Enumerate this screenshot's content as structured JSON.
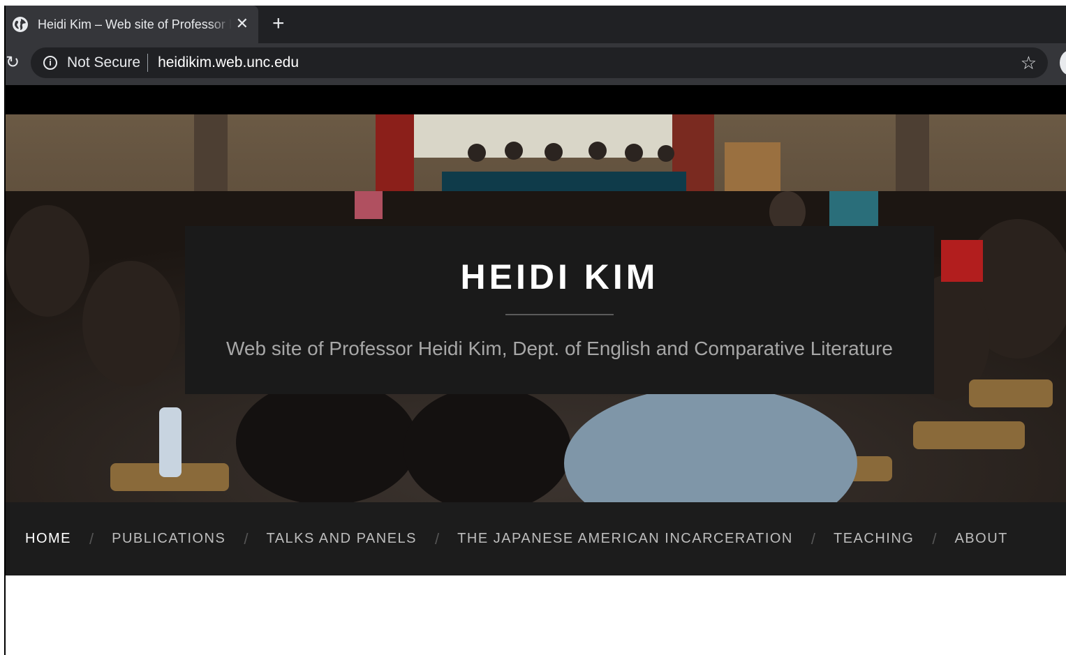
{
  "browser": {
    "tab_title": "Heidi Kim – Web site of Professor Heidi Kim, Dept. of English and Comparative Literature",
    "tab_close": "✕",
    "new_tab": "+",
    "reload_glyph": "↻",
    "security_label": "Not Secure",
    "url": "heidikim.web.unc.edu",
    "bookmark_glyph": "☆",
    "icons": [
      "globe-icon",
      "close-icon",
      "plus-icon",
      "reload-icon",
      "info-icon",
      "star-icon"
    ]
  },
  "site": {
    "title": "HEIDI KIM",
    "tagline": "Web site of Professor Heidi Kim, Dept. of English and Comparative Literature"
  },
  "nav": {
    "separator": "/",
    "items": [
      {
        "label": "HOME",
        "active": true
      },
      {
        "label": "PUBLICATIONS",
        "active": false
      },
      {
        "label": "TALKS AND PANELS",
        "active": false
      },
      {
        "label": "THE JAPANESE AMERICAN INCARCERATION",
        "active": false
      },
      {
        "label": "TEACHING",
        "active": false
      },
      {
        "label": "ABOUT",
        "active": false
      }
    ]
  },
  "colors": {
    "nav_background": "#1c1c1c",
    "title_box": "#1a1a1a",
    "chrome_dark": "#202124",
    "chrome_tab": "#35363a"
  }
}
